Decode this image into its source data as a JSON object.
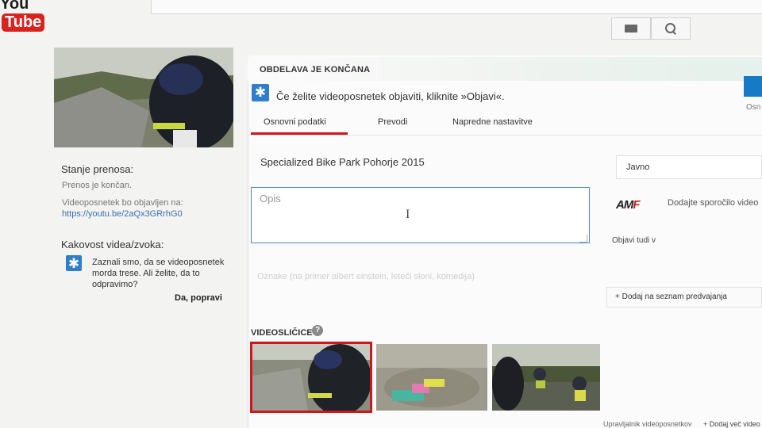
{
  "header": {
    "logo_text": "You",
    "logo_tube": "Tube"
  },
  "left": {
    "status_heading": "Stanje prenosa:",
    "status_value": "Prenos je končan.",
    "url_intro": "Videoposnetek bo objavljen na:",
    "url": "https://youtu.be/2aQx3GRrhG0",
    "quality_heading": "Kakovost videa/zvoka:",
    "quality_message": "Zaznali smo, da se videoposnetek morda trese. Ali želite, da to odpravimo?",
    "fix_label": "Da, popravi"
  },
  "main": {
    "status_title": "OBDELAVA JE KONČANA",
    "publish_message": "Če želite videoposnetek objaviti, kliknite »Objavi«.",
    "publish_partial": "Osn",
    "tabs": [
      {
        "label": "Osnovni podatki",
        "active": true
      },
      {
        "label": "Prevodi",
        "active": false
      },
      {
        "label": "Napredne nastavitve",
        "active": false
      }
    ],
    "title_value": "Specialized Bike Park Pohorje 2015",
    "description_placeholder": "Opis",
    "tags_placeholder": "Oznake (na primer albert einstein, leteči sloni, komedija)",
    "thumbnails_label": "VIDEOSLIČICE",
    "help_glyph": "?"
  },
  "right": {
    "privacy_value": "Javno",
    "amf_text_a": "AM",
    "amf_text_b": "F",
    "share_text": "Dodajte sporočilo video",
    "also_publish": "Objavi tudi v",
    "playlist_label": "+ Dodaj na seznam predvajanja"
  },
  "footer": {
    "bottom_text": "Upravljalnik videoposnetkov",
    "add_more": "+ Dodaj več video"
  },
  "colors": {
    "accent_red": "#cc181e",
    "link_blue": "#3a6fb0",
    "info_blue": "#2f7ecb",
    "publish_blue": "#167ac6"
  },
  "icons": [
    "keyboard-icon",
    "search-icon",
    "info-star-icon",
    "help-icon"
  ]
}
